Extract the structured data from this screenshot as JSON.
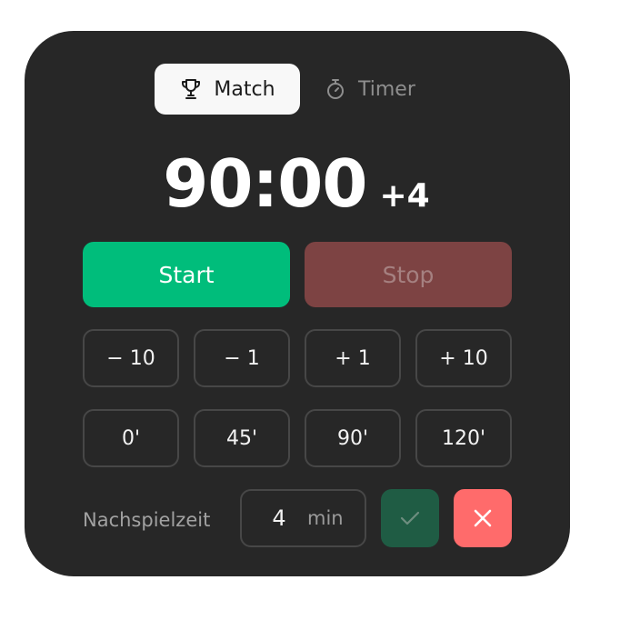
{
  "tabs": {
    "match": {
      "label": "Match",
      "icon": "trophy-icon",
      "active": true
    },
    "timer": {
      "label": "Timer",
      "icon": "stopwatch-icon",
      "active": false
    }
  },
  "clock": {
    "time": "90:00",
    "added_time": "+4"
  },
  "controls": {
    "start_label": "Start",
    "stop_label": "Stop"
  },
  "adjust": [
    "− 10",
    "− 1",
    "+ 1",
    "+ 10"
  ],
  "presets": [
    "0'",
    "45'",
    "90'",
    "120'"
  ],
  "extra_time": {
    "label": "Nachspielzeit",
    "value": "4",
    "unit": "min",
    "confirm_icon": "check-icon",
    "cancel_icon": "close-icon"
  },
  "colors": {
    "panel": "#272727",
    "start": "#00bd7b",
    "stop": "#7d4343",
    "confirm": "#1f5c44",
    "cancel": "#ff6b6b"
  }
}
